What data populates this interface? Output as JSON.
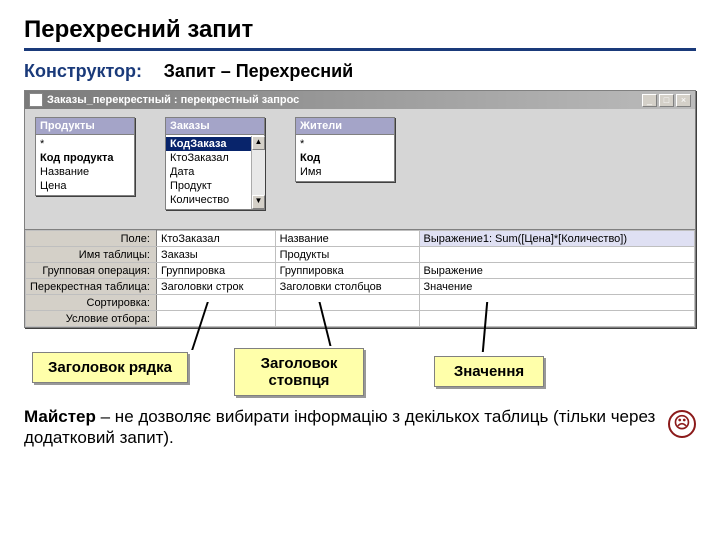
{
  "slide": {
    "title": "Перехресний запит",
    "designer_label": "Конструктор:",
    "subtitle": "Запит – Перехресний"
  },
  "window": {
    "title": "Заказы_перекрестный : перекрестный запрос",
    "btn_min": "_",
    "btn_max": "□",
    "btn_close": "×"
  },
  "tables": {
    "t1": {
      "name": "Продукты",
      "fields": [
        "*",
        "Код продукта",
        "Название",
        "Цена"
      ],
      "bold_idx": 1
    },
    "t2": {
      "name": "Заказы",
      "fields": [
        "КодЗаказа",
        "КтоЗаказал",
        "Дата",
        "Продукт",
        "Количество"
      ],
      "hi_idx": 0
    },
    "t3": {
      "name": "Жители",
      "fields": [
        "*",
        "Код",
        "Имя"
      ],
      "bold_idx": 1
    }
  },
  "grid": {
    "rows": [
      "Поле:",
      "Имя таблицы:",
      "Групповая операция:",
      "Перекрестная таблица:",
      "Сортировка:",
      "Условие отбора:"
    ],
    "cols": [
      [
        "КтоЗаказал",
        "Заказы",
        "Группировка",
        "Заголовки строк",
        "",
        ""
      ],
      [
        "Название",
        "Продукты",
        "Группировка",
        "Заголовки столбцов",
        "",
        ""
      ],
      [
        "Выражение1: Sum([Цена]*[Количество])",
        "",
        "Выражение",
        "Значение",
        "",
        ""
      ]
    ]
  },
  "callouts": {
    "c1": "Заголовок рядка",
    "c2": "Заголовок стовпця",
    "c3": "Значення"
  },
  "bottom": {
    "lead": "Майстер",
    "rest": " – не дозволяє вибирати інформацію з декількох таблиць (тільки через додатковий запит).",
    "face": "☹"
  }
}
